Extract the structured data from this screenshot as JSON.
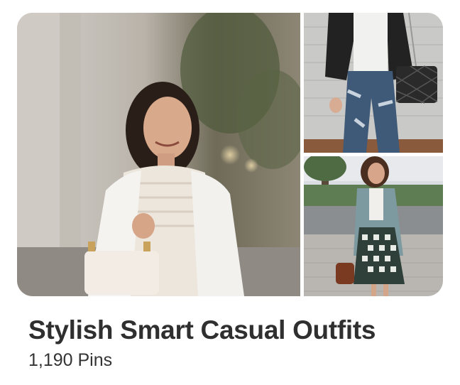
{
  "board": {
    "title": "Stylish Smart Casual Outfits",
    "pin_count": "1,190 Pins"
  },
  "images": {
    "cover": "woman-white-lace-blazer-handbag",
    "top_right": "ripped-jeans-black-blazer-quilted-bag",
    "bottom_right": "woman-teal-blazer-check-skirt-street"
  }
}
